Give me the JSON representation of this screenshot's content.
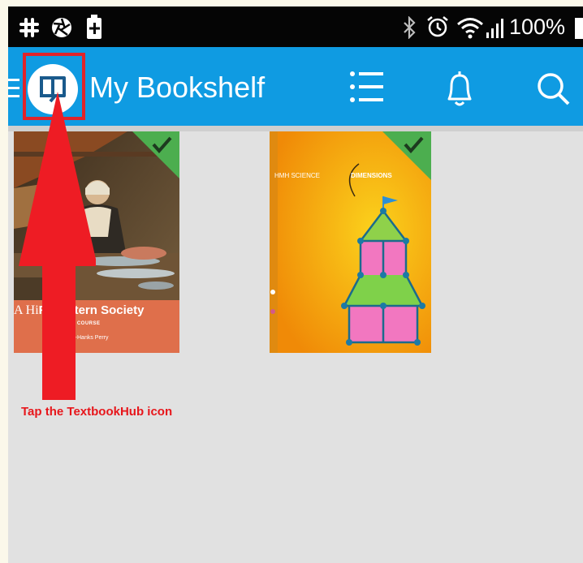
{
  "status_bar": {
    "left_icons": [
      "slack-icon",
      "aperture-icon",
      "battery-saver-icon"
    ],
    "right_icons": [
      "bluetooth-icon",
      "alarm-icon",
      "wifi-icon",
      "signal-icon"
    ],
    "battery_text": "100%"
  },
  "app_bar": {
    "title": "My Bookshelf",
    "background": "#0f9be2",
    "icons": [
      "menu-icon",
      "textbookhub-logo-icon",
      "list-icon",
      "bell-icon",
      "search-icon"
    ]
  },
  "books": [
    {
      "title_lead": "A Hi",
      "title_strong": "F Western Society",
      "subtitle": "H THE AP COURSE",
      "authors": "Wiesner-Hanks    Perry",
      "downloaded": true
    },
    {
      "brand": "HMH SCIENCE",
      "series": "DIMENSIONS",
      "downloaded": true
    }
  ],
  "annotation": {
    "text": "Tap the TextbookHub icon",
    "color": "#e7161b"
  }
}
